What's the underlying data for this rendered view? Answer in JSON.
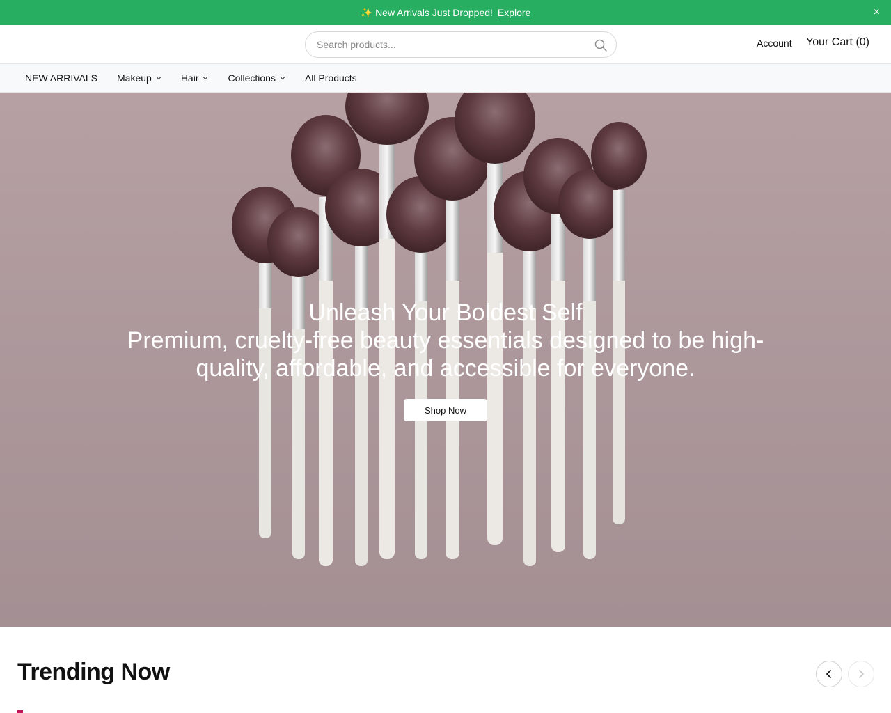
{
  "announcement": {
    "spark_icon": "sparkles-icon",
    "text": "New Arrivals Just Dropped!",
    "link": "Explore",
    "close": "×"
  },
  "header": {
    "search_placeholder": "Search products...",
    "account": "Account",
    "cart": "Your Cart (0)"
  },
  "nav": {
    "items": [
      {
        "label": "NEW ARRIVALS",
        "dropdown": false
      },
      {
        "label": "Makeup",
        "dropdown": true
      },
      {
        "label": "Hair",
        "dropdown": true
      },
      {
        "label": "Collections",
        "dropdown": true
      },
      {
        "label": "All Products",
        "dropdown": false
      }
    ]
  },
  "hero": {
    "title": "Unleash Your Boldest Self",
    "subtitle": "Premium, cruelty-free beauty essentials designed to be high-quality, affordable, and accessible for everyone.",
    "cta": "Shop Now"
  },
  "trending": {
    "title": "Trending Now"
  },
  "colors": {
    "announcement_bg": "#27ae60",
    "hero_bg": "#ad989c",
    "nav_bg": "#f8f9fb"
  }
}
